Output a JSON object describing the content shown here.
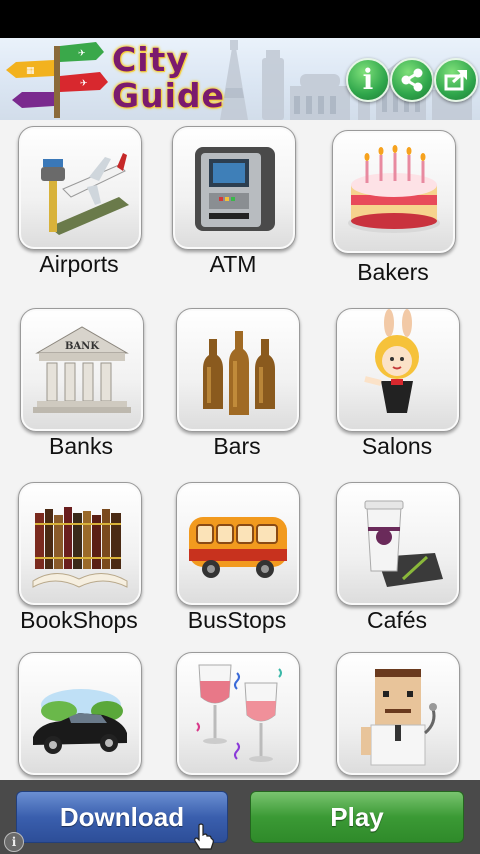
{
  "app": {
    "title_line1": "City",
    "title_line2": "Guide"
  },
  "header_buttons": [
    {
      "icon": "info-icon",
      "label": "i"
    },
    {
      "icon": "share-icon"
    },
    {
      "icon": "export-icon"
    }
  ],
  "categories": [
    {
      "label": "Airports",
      "icon": "airport-icon"
    },
    {
      "label": "ATM",
      "icon": "atm-icon"
    },
    {
      "label": "Bakers",
      "icon": "cake-icon"
    },
    {
      "label": "Banks",
      "icon": "bank-icon",
      "sign": "BANK"
    },
    {
      "label": "Bars",
      "icon": "beer-bottles-icon"
    },
    {
      "label": "Salons",
      "icon": "salon-girl-icon"
    },
    {
      "label": "BookShops",
      "icon": "books-icon"
    },
    {
      "label": "BusStops",
      "icon": "bus-icon"
    },
    {
      "label": "Cafés",
      "icon": "coffee-cup-icon"
    },
    {
      "label": "",
      "icon": "car-icon"
    },
    {
      "label": "",
      "icon": "wine-glasses-icon"
    },
    {
      "label": "",
      "icon": "doctor-icon"
    }
  ],
  "ad": {
    "download_label": "Download",
    "play_label": "Play",
    "info_label": "i"
  },
  "colors": {
    "title_purple": "#7a1a6e",
    "title_outline": "#f6cf3a",
    "header_button_green": "#2fa64b",
    "download_blue": "#3a5fae",
    "play_green": "#3b9a35"
  }
}
